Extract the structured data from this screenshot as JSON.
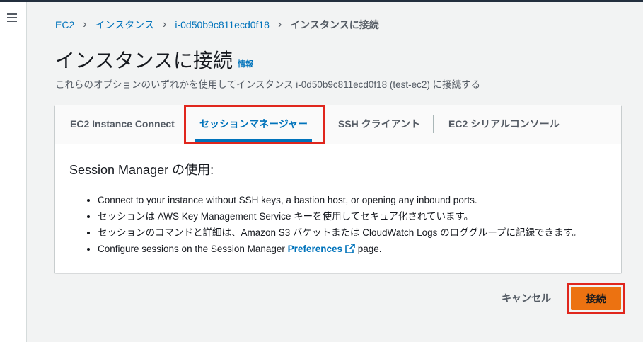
{
  "breadcrumb": {
    "items": [
      "EC2",
      "インスタンス",
      "i-0d50b9c811ecd0f18"
    ],
    "current": "インスタンスに接続"
  },
  "page": {
    "title": "インスタンスに接続",
    "info_label": "情報",
    "subtitle": "これらのオプションのいずれかを使用してインスタンス i-0d50b9c811ecd0f18 (test-ec2) に接続する"
  },
  "tabs": [
    {
      "label": "EC2 Instance Connect",
      "active": false
    },
    {
      "label": "セッションマネージャー",
      "active": true
    },
    {
      "label": "SSH クライアント",
      "active": false
    },
    {
      "label": "EC2 シリアルコンソール",
      "active": false
    }
  ],
  "session_manager": {
    "heading": "Session Manager の使用:",
    "bullets": [
      "Connect to your instance without SSH keys, a bastion host, or opening any inbound ports.",
      "セッションは AWS Key Management Service キーを使用してセキュア化されています。",
      "セッションのコマンドと詳細は、Amazon S3 バケットまたは CloudWatch Logs のロググループに記録できます。"
    ],
    "last_bullet": {
      "prefix": "Configure sessions on the Session Manager",
      "link": "Preferences",
      "suffix": "page."
    }
  },
  "actions": {
    "cancel_label": "キャンセル",
    "connect_label": "接続"
  },
  "colors": {
    "link": "#0073bb",
    "primary_button": "#ec7211",
    "highlight_box": "#e0261d"
  },
  "icons": [
    "menu-icon",
    "chevron-right-icon",
    "external-link-icon"
  ]
}
